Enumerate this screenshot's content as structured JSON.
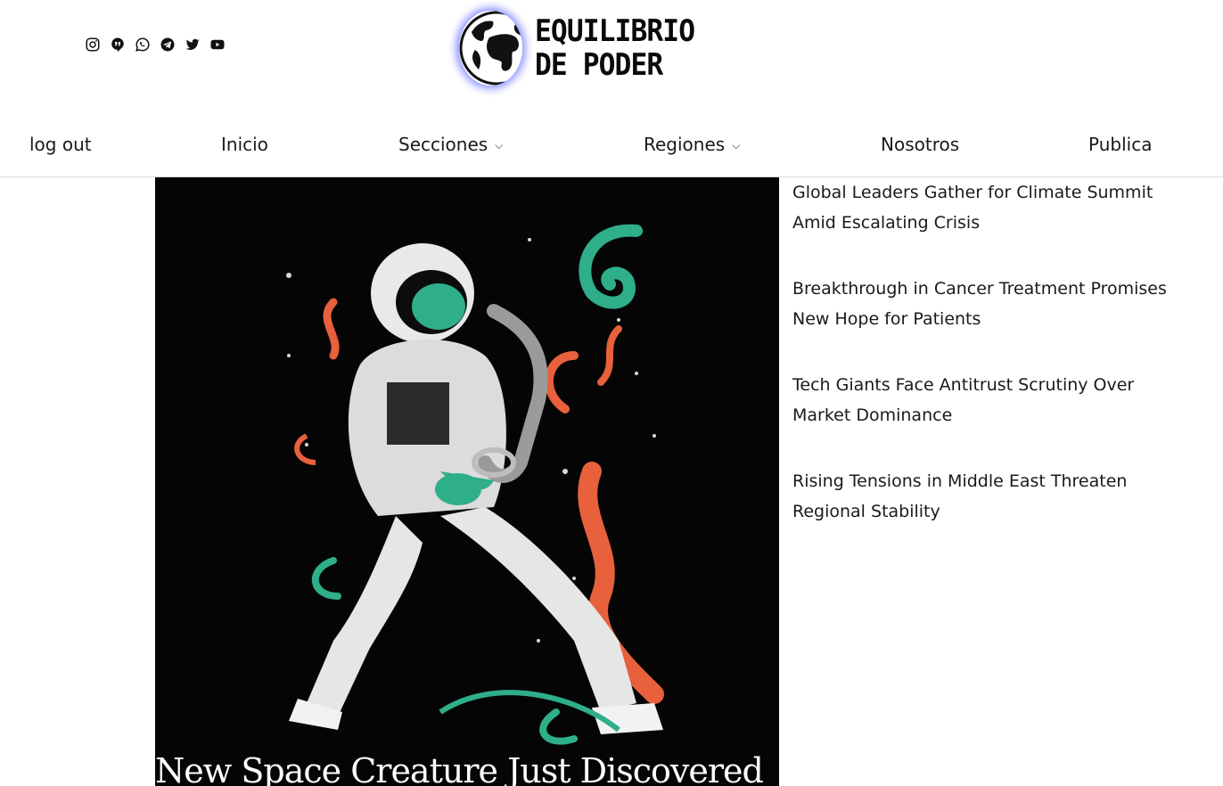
{
  "header": {
    "social_icons": [
      "instagram-icon",
      "quote-icon",
      "whatsapp-icon",
      "telegram-icon",
      "twitter-icon",
      "youtube-icon"
    ],
    "logo": {
      "line1": "EQUILIBRIO",
      "line2": "DE PODER",
      "glow_color": "#7d86ff"
    }
  },
  "nav": {
    "items": [
      {
        "label": "log out"
      },
      {
        "label": "Inicio"
      },
      {
        "label": "Secciones",
        "has_dropdown": true
      },
      {
        "label": "Regiones",
        "has_dropdown": true
      },
      {
        "label": "Nosotros"
      },
      {
        "label": "Publica"
      }
    ]
  },
  "featured": {
    "title": "New Space Creature Just Discovered",
    "accent_colors": [
      "#2fae8a",
      "#e8603c"
    ]
  },
  "headlines": [
    {
      "title": "Global Leaders Gather for Climate Summit Amid Escalating Crisis"
    },
    {
      "title": "Breakthrough in Cancer Treatment Promises New Hope for Patients"
    },
    {
      "title": "Tech Giants Face Antitrust Scrutiny Over Market Dominance"
    },
    {
      "title": "Rising Tensions in Middle East Threaten Regional Stability"
    }
  ]
}
